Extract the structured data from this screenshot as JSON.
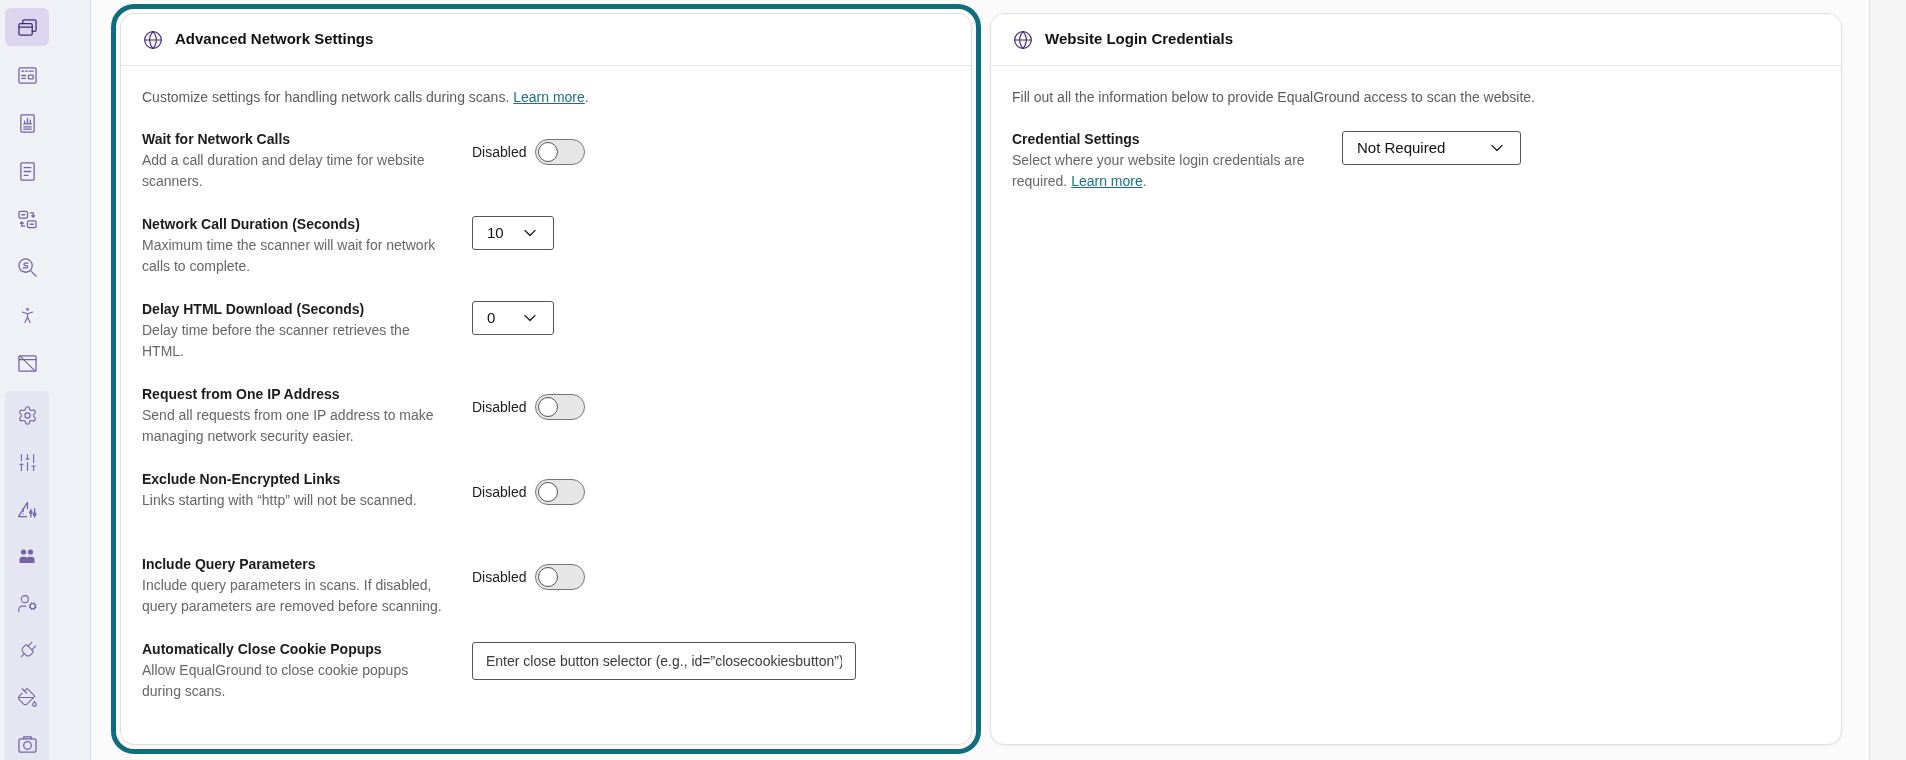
{
  "sidebar": {
    "items": [
      {
        "selected": true
      },
      {
        "selected": false
      },
      {
        "selected": false
      },
      {
        "selected": false
      },
      {
        "selected": false
      },
      {
        "selected": false
      },
      {
        "selected": false
      },
      {
        "selected": false
      }
    ],
    "settings_group": {
      "items": [
        {
          "selected": false
        },
        {
          "selected": false
        },
        {
          "selected": false
        },
        {
          "selected": false
        },
        {
          "selected": false
        },
        {
          "selected": false
        },
        {
          "selected": false
        },
        {
          "selected": false
        }
      ]
    }
  },
  "cards": [
    {
      "title": "Advanced Network Settings",
      "focused": true,
      "intro": "Customize settings for handling network calls during scans. ",
      "intro_link": "Learn more",
      "intro_after": ".",
      "settings": [
        {
          "kind": "toggle",
          "title": "Wait for Network Calls",
          "description": "Add a call duration and delay time for website scanners.",
          "state_label": "Disabled",
          "on": false
        },
        {
          "kind": "select",
          "title": "Network Call Duration (Seconds)",
          "description": "Maximum time the scanner will wait for network calls to complete.",
          "value": "10"
        },
        {
          "kind": "select",
          "title": "Delay HTML Download (Seconds)",
          "description": "Delay time before the scanner retrieves the HTML.",
          "value": "0"
        },
        {
          "kind": "toggle",
          "title": "Request from One IP Address",
          "description": "Send all requests from one IP address to make managing network security easier.",
          "state_label": "Disabled",
          "on": false
        },
        {
          "kind": "toggle",
          "title": "Exclude Non-Encrypted Links",
          "description": "Links starting with “http” will not be scanned.",
          "state_label": "Disabled",
          "on": false
        },
        {
          "kind": "toggle",
          "title": "Include Query Parameters",
          "description": "Include query parameters in scans. If disabled, query parameters are removed before scanning.",
          "state_label": "Disabled",
          "on": false
        },
        {
          "kind": "text_input",
          "title": "Automatically Close Cookie Popups",
          "description": "Allow EqualGround to close cookie popups during scans.",
          "placeholder": "Enter close button selector (e.g., id=”closecookiesbutton”)"
        }
      ]
    },
    {
      "title": "Website Login Credentials",
      "focused": false,
      "intro": "Fill out all the information below to provide EqualGround access to scan the website.",
      "settings": [
        {
          "kind": "select",
          "title": "Credential Settings",
          "description": "Select where your website login credentials are required. ",
          "link": "Learn more",
          "link_after": ".",
          "value": "Not Required"
        }
      ]
    }
  ]
}
